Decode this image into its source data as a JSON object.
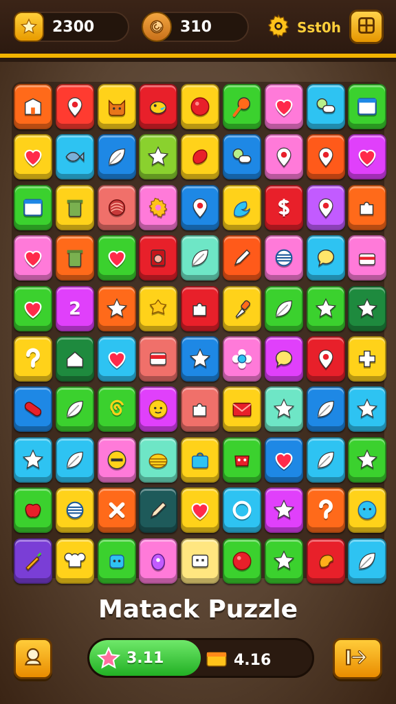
{
  "hud": {
    "coins": "2300",
    "gems": "310",
    "settings_value": "Sst0h"
  },
  "title": "Matack Puzzle",
  "progress": {
    "label": "3.11",
    "fill_fraction": 0.5,
    "timer": "4.16"
  },
  "colors": {
    "accent": "#f2b400",
    "progress_green": "#3ccf3a"
  },
  "board": {
    "rows": [
      [
        {
          "color": "#ff6a1a",
          "icon": "building-icon"
        },
        {
          "color": "#ff3b30",
          "icon": "map-pin-icon"
        },
        {
          "color": "#ffd21a",
          "icon": "cat-face-icon"
        },
        {
          "color": "#e8202a",
          "icon": "bird-icon"
        },
        {
          "color": "#ffd21a",
          "icon": "red-ball-icon"
        },
        {
          "color": "#3bd12e",
          "icon": "magnifier-icon"
        },
        {
          "color": "#ff7ad9",
          "icon": "heart-icon"
        },
        {
          "color": "#2ec3f2",
          "icon": "toggle-icon"
        },
        {
          "color": "#3bd12e",
          "icon": "window-icon"
        }
      ],
      [
        {
          "color": "#ffd21a",
          "icon": "heart-icon"
        },
        {
          "color": "#2ec3f2",
          "icon": "fish-icon"
        },
        {
          "color": "#1e88e5",
          "icon": "leaf-icon"
        },
        {
          "color": "#8ad12e",
          "icon": "star-icon"
        },
        {
          "color": "#ffd21a",
          "icon": "splat-icon"
        },
        {
          "color": "#1e88e5",
          "icon": "toggle-icon"
        },
        {
          "color": "#ff7ad9",
          "icon": "map-pin-icon"
        },
        {
          "color": "#ff5a1a",
          "icon": "map-pin-icon"
        },
        {
          "color": "#e040fb",
          "icon": "heart-icon"
        }
      ],
      [
        {
          "color": "#3bd12e",
          "icon": "window-icon"
        },
        {
          "color": "#ffd21a",
          "icon": "trash-icon"
        },
        {
          "color": "#f0706a",
          "icon": "shell-icon"
        },
        {
          "color": "#ff7ad9",
          "icon": "gear-icon"
        },
        {
          "color": "#1e88e5",
          "icon": "map-pin-icon"
        },
        {
          "color": "#ffd21a",
          "icon": "wave-icon"
        },
        {
          "color": "#e8202a",
          "icon": "dollar-icon"
        },
        {
          "color": "#c25bff",
          "icon": "map-pin-icon"
        },
        {
          "color": "#ff6a1a",
          "icon": "puzzle-icon"
        }
      ],
      [
        {
          "color": "#ff7ad9",
          "icon": "heart-icon"
        },
        {
          "color": "#ff6a1a",
          "icon": "trash-icon"
        },
        {
          "color": "#3bd12e",
          "icon": "heart-icon"
        },
        {
          "color": "#e8202a",
          "icon": "speaker-icon"
        },
        {
          "color": "#6ee6c6",
          "icon": "leaf-icon"
        },
        {
          "color": "#ff5a1a",
          "icon": "pen-icon"
        },
        {
          "color": "#ff7ad9",
          "icon": "stripes-icon"
        },
        {
          "color": "#2ec3f2",
          "icon": "chat-bubble-icon"
        },
        {
          "color": "#ff7ad9",
          "icon": "briefcase-icon"
        }
      ],
      [
        {
          "color": "#3bd12e",
          "icon": "heart-icon"
        },
        {
          "color": "#e040fb",
          "icon": "number-two-icon"
        },
        {
          "color": "#ff6a1a",
          "icon": "star-icon"
        },
        {
          "color": "#ffd21a",
          "icon": "cookie-icon"
        },
        {
          "color": "#e8202a",
          "icon": "puzzle-icon"
        },
        {
          "color": "#ffd21a",
          "icon": "brush-icon"
        },
        {
          "color": "#3bd12e",
          "icon": "leaf-icon"
        },
        {
          "color": "#3bd12e",
          "icon": "star-icon"
        },
        {
          "color": "#1e8a3e",
          "icon": "star-icon"
        }
      ],
      [
        {
          "color": "#ffd21a",
          "icon": "hook-icon"
        },
        {
          "color": "#1e8a3e",
          "icon": "house-icon"
        },
        {
          "color": "#2ec3f2",
          "icon": "heart-icon"
        },
        {
          "color": "#f0706a",
          "icon": "card-icon"
        },
        {
          "color": "#1e88e5",
          "icon": "star-icon"
        },
        {
          "color": "#ff7ad9",
          "icon": "flower-icon"
        },
        {
          "color": "#e040fb",
          "icon": "chat-bubble-icon"
        },
        {
          "color": "#e8202a",
          "icon": "map-pin-icon"
        },
        {
          "color": "#ffd21a",
          "icon": "plus-icon"
        }
      ],
      [
        {
          "color": "#1e88e5",
          "icon": "sausage-icon"
        },
        {
          "color": "#3bd12e",
          "icon": "leaf-icon"
        },
        {
          "color": "#3bd12e",
          "icon": "spiral-icon"
        },
        {
          "color": "#e040fb",
          "icon": "smiley-icon"
        },
        {
          "color": "#f0706a",
          "icon": "puzzle-icon"
        },
        {
          "color": "#ffd21a",
          "icon": "envelope-icon"
        },
        {
          "color": "#6ee6c6",
          "icon": "star-icon"
        },
        {
          "color": "#1e88e5",
          "icon": "leaf-icon"
        },
        {
          "color": "#2ec3f2",
          "icon": "star-icon"
        }
      ],
      [
        {
          "color": "#2ec3f2",
          "icon": "star-icon"
        },
        {
          "color": "#2ec3f2",
          "icon": "leaf-icon"
        },
        {
          "color": "#ff7ad9",
          "icon": "minus-circle-icon"
        },
        {
          "color": "#6ee6c6",
          "icon": "beehive-icon"
        },
        {
          "color": "#ffd21a",
          "icon": "bag-icon"
        },
        {
          "color": "#3bd12e",
          "icon": "monster-icon"
        },
        {
          "color": "#1e88e5",
          "icon": "heart-icon"
        },
        {
          "color": "#2ec3f2",
          "icon": "leaf-icon"
        },
        {
          "color": "#3bd12e",
          "icon": "star-icon"
        }
      ],
      [
        {
          "color": "#3bd12e",
          "icon": "apple-icon"
        },
        {
          "color": "#ffd21a",
          "icon": "stripes-icon"
        },
        {
          "color": "#ff6a1a",
          "icon": "cross-icon"
        },
        {
          "color": "#1e5a5a",
          "icon": "pencil-icon"
        },
        {
          "color": "#ffd21a",
          "icon": "heart-icon"
        },
        {
          "color": "#2ec3f2",
          "icon": "ring-icon"
        },
        {
          "color": "#e040fb",
          "icon": "star-icon"
        },
        {
          "color": "#ff6a1a",
          "icon": "hook-icon"
        },
        {
          "color": "#ffd21a",
          "icon": "blue-face-icon"
        }
      ],
      [
        {
          "color": "#7a3ed6",
          "icon": "carrot-icon"
        },
        {
          "color": "#ffd21a",
          "icon": "chef-hat-icon"
        },
        {
          "color": "#3bd12e",
          "icon": "robot-icon"
        },
        {
          "color": "#ff7ad9",
          "icon": "egg-icon"
        },
        {
          "color": "#ffe680",
          "icon": "face-icon"
        },
        {
          "color": "#3bd12e",
          "icon": "red-ball-icon"
        },
        {
          "color": "#3bd12e",
          "icon": "star-icon"
        },
        {
          "color": "#e8202a",
          "icon": "shrimp-icon"
        },
        {
          "color": "#2ec3f2",
          "icon": "leaf-icon"
        }
      ]
    ]
  }
}
